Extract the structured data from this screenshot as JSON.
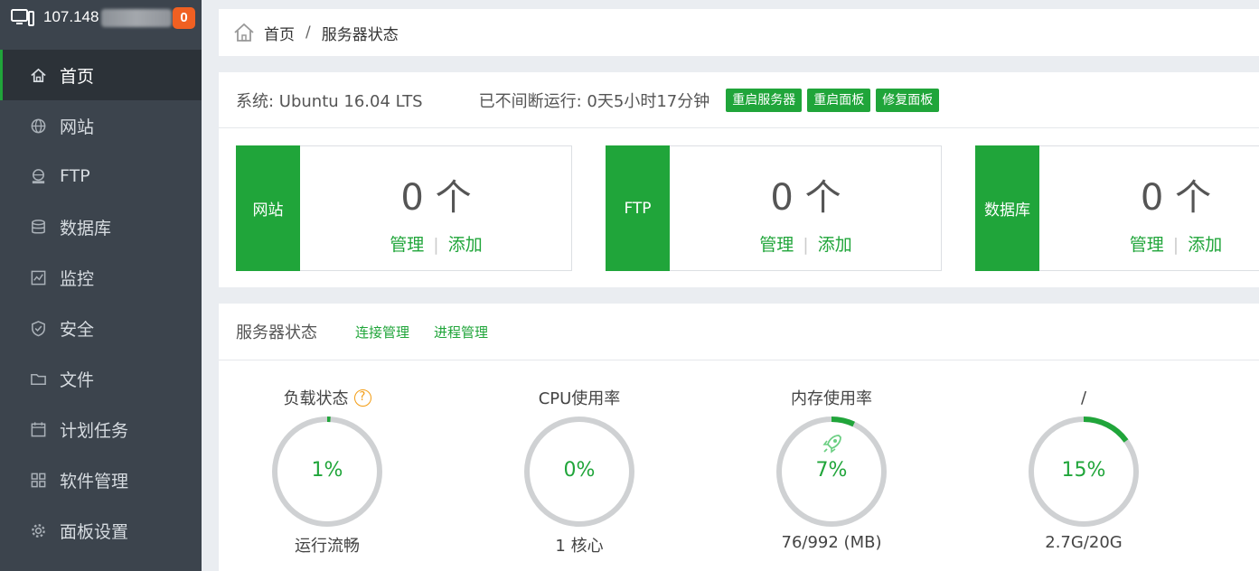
{
  "sidebar": {
    "ip": "107.148",
    "badge": "0",
    "items": [
      {
        "label": "首页",
        "icon": "home-icon"
      },
      {
        "label": "网站",
        "icon": "globe-icon"
      },
      {
        "label": "FTP",
        "icon": "ftp-icon"
      },
      {
        "label": "数据库",
        "icon": "database-icon"
      },
      {
        "label": "监控",
        "icon": "monitor-icon"
      },
      {
        "label": "安全",
        "icon": "shield-icon"
      },
      {
        "label": "文件",
        "icon": "folder-icon"
      },
      {
        "label": "计划任务",
        "icon": "calendar-icon"
      },
      {
        "label": "软件管理",
        "icon": "grid-icon"
      },
      {
        "label": "面板设置",
        "icon": "gear-icon"
      }
    ]
  },
  "breadcrumb": {
    "home": "首页",
    "separator": "/",
    "current": "服务器状态"
  },
  "system": {
    "os_text": "系统: Ubuntu 16.04 LTS",
    "uptime_text": "已不间断运行: 0天5小时17分钟",
    "buttons": [
      "重启服务器",
      "重启面板",
      "修复面板"
    ]
  },
  "cards": [
    {
      "tag": "网站",
      "count": "0 个",
      "manage": "管理",
      "add": "添加"
    },
    {
      "tag": "FTP",
      "count": "0 个",
      "manage": "管理",
      "add": "添加"
    },
    {
      "tag": "数据库",
      "count": "0 个",
      "manage": "管理",
      "add": "添加"
    }
  ],
  "status": {
    "title": "服务器状态",
    "links": [
      "连接管理",
      "进程管理"
    ],
    "gauges": [
      {
        "label": "负载状态",
        "help": "?",
        "value": "1%",
        "percent": 1,
        "sub": "运行流畅"
      },
      {
        "label": "CPU使用率",
        "value": "0%",
        "percent": 0,
        "sub": "1 核心"
      },
      {
        "label": "内存使用率",
        "value": "7%",
        "percent": 7,
        "sub": "76/992 (MB)",
        "icon": "rocket-icon"
      },
      {
        "label": "/",
        "value": "15%",
        "percent": 15,
        "sub": "2.7G/20G"
      }
    ]
  },
  "colors": {
    "accent": "#20a53a",
    "sidebar_bg": "#3c444d",
    "badge": "#f06022",
    "ring_track": "#cfd1d3"
  }
}
